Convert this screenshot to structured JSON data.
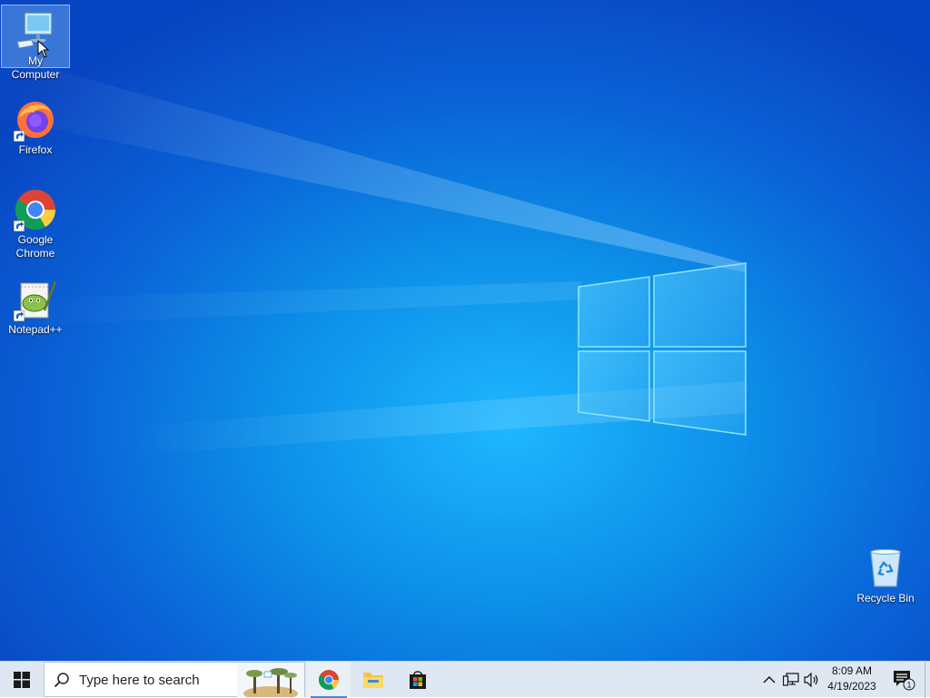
{
  "desktop": {
    "icons": [
      {
        "label": "My Computer",
        "icon": "computer-icon",
        "selected": true
      },
      {
        "label": "Firefox",
        "icon": "firefox-icon",
        "shortcut": true
      },
      {
        "label": "Google\nChrome",
        "icon": "chrome-icon",
        "shortcut": true
      },
      {
        "label": "Notepad++",
        "icon": "notepadpp-icon",
        "shortcut": true
      },
      {
        "label": "Recycle Bin",
        "icon": "recycle-bin-icon"
      }
    ],
    "wallpaper": "windows-10-light-beam"
  },
  "taskbar": {
    "start_icon": "windows-start-icon",
    "search": {
      "placeholder": "Type here to search",
      "value": ""
    },
    "pinned_apps": [
      {
        "name": "Google Chrome",
        "icon": "chrome-icon",
        "active": true
      },
      {
        "name": "File Explorer",
        "icon": "folder-icon"
      },
      {
        "name": "Microsoft Store",
        "icon": "store-icon"
      }
    ],
    "tray": {
      "icons": [
        "chevron-up-icon",
        "network-icon",
        "volume-icon"
      ],
      "time": "8:09 AM",
      "date": "4/19/2023",
      "notifications_icon": "notification-icon",
      "notification_count": "1"
    }
  },
  "colors": {
    "taskbar_bg": "#dfe8f2",
    "desktop_blue": "#0a62d6",
    "accent": "#0078d7"
  }
}
